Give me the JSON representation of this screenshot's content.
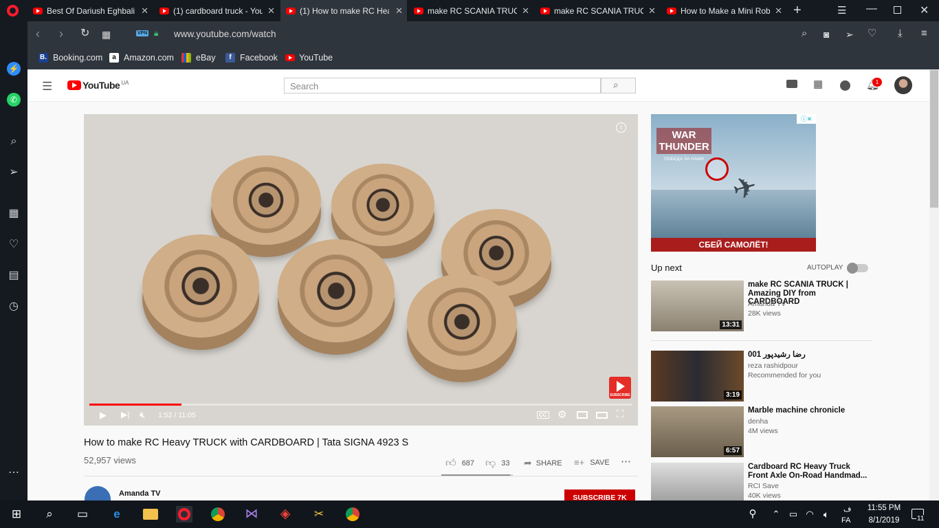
{
  "tabs": [
    {
      "title": "Best Of Dariush Eghbali",
      "active": false
    },
    {
      "title": "(1) cardboard truck - You",
      "active": false
    },
    {
      "title": "(1) How to make RC Hea",
      "active": true
    },
    {
      "title": "make RC SCANIA TRUCK",
      "active": false
    },
    {
      "title": "make RC SCANIA TRUCK",
      "active": false
    },
    {
      "title": "How to Make a Mini Rob",
      "active": false
    }
  ],
  "address": {
    "vpn": "VPN",
    "url": "www.youtube.com/watch"
  },
  "bookmarks": [
    {
      "label": "Booking.com",
      "icon": "B."
    },
    {
      "label": "Amazon.com",
      "icon": "a"
    },
    {
      "label": "eBay",
      "icon": ""
    },
    {
      "label": "Facebook",
      "icon": "f"
    },
    {
      "label": "YouTube",
      "icon": ""
    }
  ],
  "youtube": {
    "logo": "YouTube",
    "region": "UA",
    "search_placeholder": "Search",
    "notification_count": "1"
  },
  "player": {
    "time": "1:52 / 11:05",
    "progress": 0.17,
    "subscribe_badge": "SUBSCRIBE"
  },
  "video": {
    "title": "How to make RC Heavy TRUCK with CARDBOARD | Tata SIGNA 4923 S",
    "views": "52,957 views",
    "likes": "687",
    "dislikes": "33",
    "share": "SHARE",
    "save": "SAVE",
    "channel": "Amanda TV",
    "subscribe": "SUBSCRIBE 7K"
  },
  "ad": {
    "brand": "WAR THUNDER",
    "tagline": "ПОБЕДА ЗА НАМИ",
    "cta": "СБЕЙ САМОЛЁТ!"
  },
  "sidebar_list": {
    "up_next": "Up next",
    "autoplay": "AUTOPLAY",
    "items": [
      {
        "title": "make RC SCANIA TRUCK | Amazing DIY from CARDBOARD",
        "channel": "Amanda TV",
        "meta": "28K views",
        "duration": "13:31"
      },
      {
        "title": "رضا رشیدپور 001",
        "channel": "reza rashidpour",
        "meta": "Recommended for you",
        "duration": "3:19"
      },
      {
        "title": "Marble machine chronicle",
        "channel": "denha",
        "meta": "4M views",
        "duration": "6:57"
      },
      {
        "title": "Cardboard RC Heavy Truck Front Axle On-Road Handmad...",
        "channel": "RCI Save",
        "meta": "40K views",
        "duration": ""
      }
    ]
  },
  "taskbar": {
    "lang": "FA",
    "time": "11:55 PM",
    "date": "8/1/2019",
    "notifications": "11",
    "kbd": "ف"
  }
}
